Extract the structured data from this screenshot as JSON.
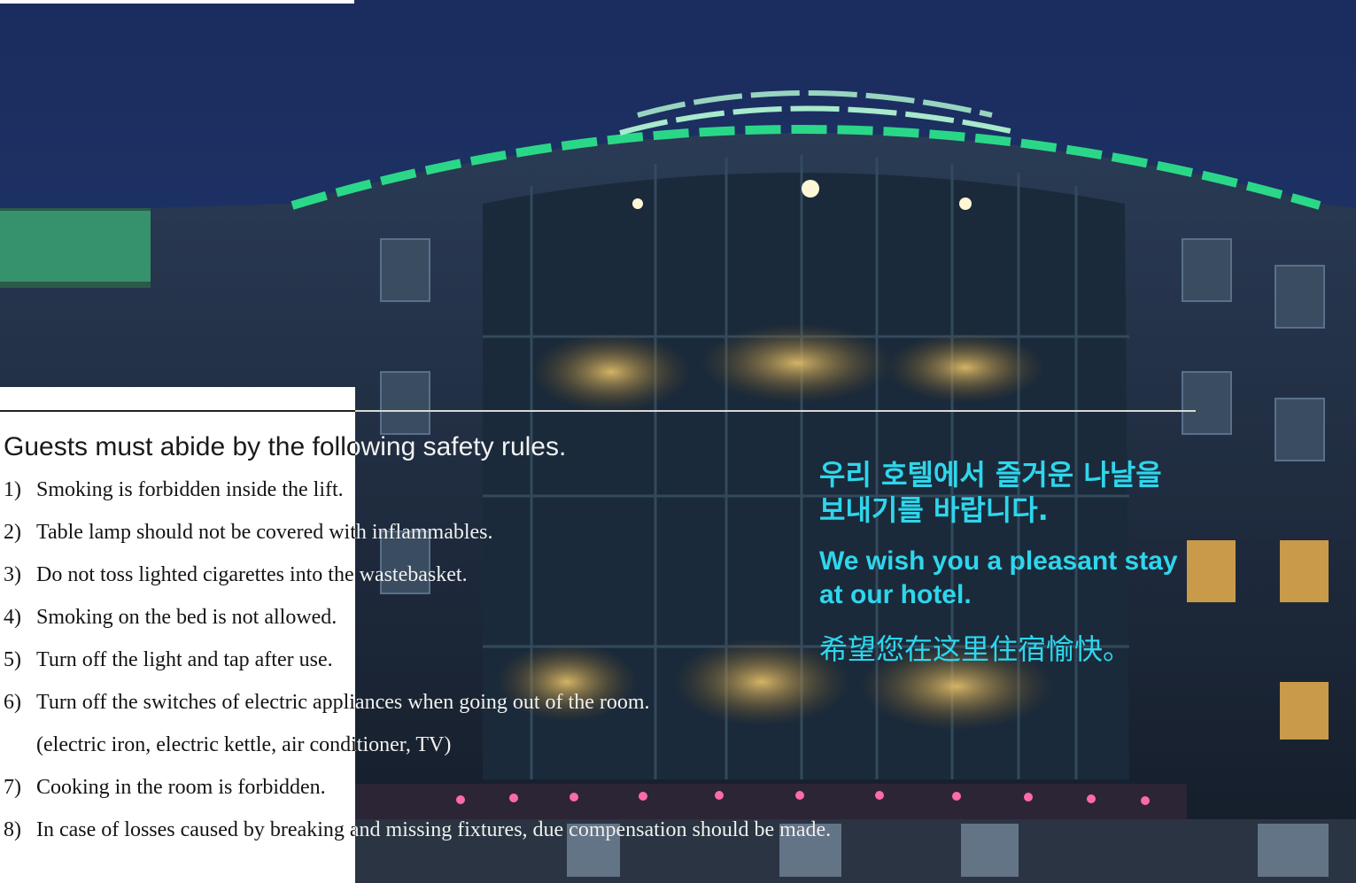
{
  "notice": {
    "heading": "Guests must abide by the following safety rules.",
    "rules": [
      {
        "num": "1)",
        "text": "Smoking is forbidden inside the lift."
      },
      {
        "num": "2)",
        "text": "Table lamp should not be covered with inflammables."
      },
      {
        "num": "3)",
        "text": "Do not toss lighted cigarettes into the wastebasket."
      },
      {
        "num": "4)",
        "text": "Smoking on the bed is not allowed."
      },
      {
        "num": "5)",
        "text": "Turn off the light and tap after use."
      },
      {
        "num": "6)",
        "text": "Turn off the switches of electric appliances when going out of the room."
      },
      {
        "num": "",
        "text": "(electric iron, electric kettle, air conditioner, TV)"
      },
      {
        "num": "7)",
        "text": "Cooking in the room is forbidden."
      },
      {
        "num": "8)",
        "text": "In case of losses caused by breaking and missing fixtures, due compensation should be made."
      }
    ]
  },
  "welcome": {
    "korean_line1": "우리 호텔에서 즐거운 나날을",
    "korean_line2": "보내기를 바랍니다.",
    "english_line1": "We wish you a pleasant stay",
    "english_line2": "at our hotel.",
    "chinese": "希望您在这里住宿愉快。"
  },
  "colors": {
    "sky": "#1c2d5a",
    "facade": "#1f2a38",
    "neon": "#2be08a",
    "welcome_text": "#2fd6ec",
    "rule_text": "#141414",
    "rule_text_on_photo": "#f2f2f2",
    "window_glow": "#c9a25a"
  }
}
